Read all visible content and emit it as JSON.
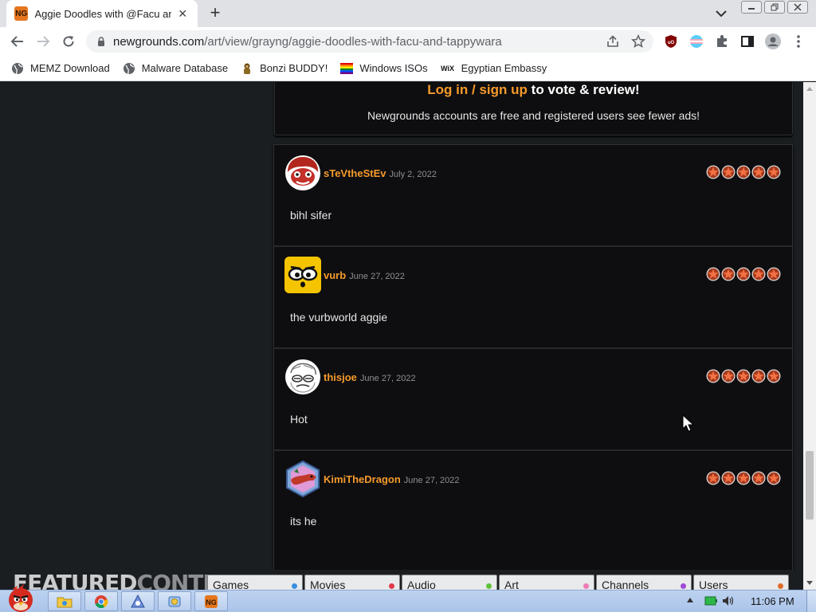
{
  "browser": {
    "tab": {
      "favicon_text": "NG",
      "title": "Aggie Doodles with @Facu an",
      "close": "✕"
    },
    "new_tab": "+",
    "url": {
      "host": "newgrounds.com",
      "path": "/art/view/grayng/aggie-doodles-with-facu-and-tappywara"
    },
    "bookmarks": [
      {
        "label": "MEMZ Download",
        "icon": "globe-icon"
      },
      {
        "label": "Malware Database",
        "icon": "globe-icon"
      },
      {
        "label": "Bonzi BUDDY!",
        "icon": "bonzi-icon"
      },
      {
        "label": "Windows ISOs",
        "icon": "rainbow-flag-icon"
      },
      {
        "label": "Egyptian Embassy",
        "icon": "wix-icon",
        "icon_text": "WiX"
      }
    ]
  },
  "login": {
    "login_link": "Log in",
    "separator": "/",
    "signup_link": "sign up",
    "suffix": "to vote & review!",
    "subtext": "Newgrounds accounts are free and registered users see fewer ads!"
  },
  "reviews": [
    {
      "user": "sTeVtheStEv",
      "date": "July 2, 2022",
      "body": "bihl sifer",
      "rating": 5,
      "avatar": "red-face-avatar"
    },
    {
      "user": "vurb",
      "date": "June 27, 2022",
      "body": "the vurbworld aggie",
      "rating": 5,
      "avatar": "yellow-face-avatar"
    },
    {
      "user": "thisjoe",
      "date": "June 27, 2022",
      "body": "Hot",
      "rating": 5,
      "avatar": "sketch-face-avatar"
    },
    {
      "user": "KimiTheDragon",
      "date": "June 27, 2022",
      "body": "its he",
      "rating": 5,
      "avatar": "dragon-avatar"
    }
  ],
  "featured": {
    "title_a": "FEATURED",
    "title_b": "CONTENT",
    "tabs": [
      {
        "label": "Games",
        "color": "#3a8fe0"
      },
      {
        "label": "Movies",
        "color": "#e03a4a"
      },
      {
        "label": "Audio",
        "color": "#5fc23a"
      },
      {
        "label": "Art",
        "color": "#f07ab8"
      },
      {
        "label": "Channels",
        "color": "#a14ad8"
      },
      {
        "label": "Users",
        "color": "#e06a2a"
      }
    ]
  },
  "taskbar": {
    "clock": "11:06 PM"
  },
  "colors": {
    "accent": "#f69a2b",
    "page_bg": "#1b1e21",
    "panel_bg": "#0e0e10"
  }
}
